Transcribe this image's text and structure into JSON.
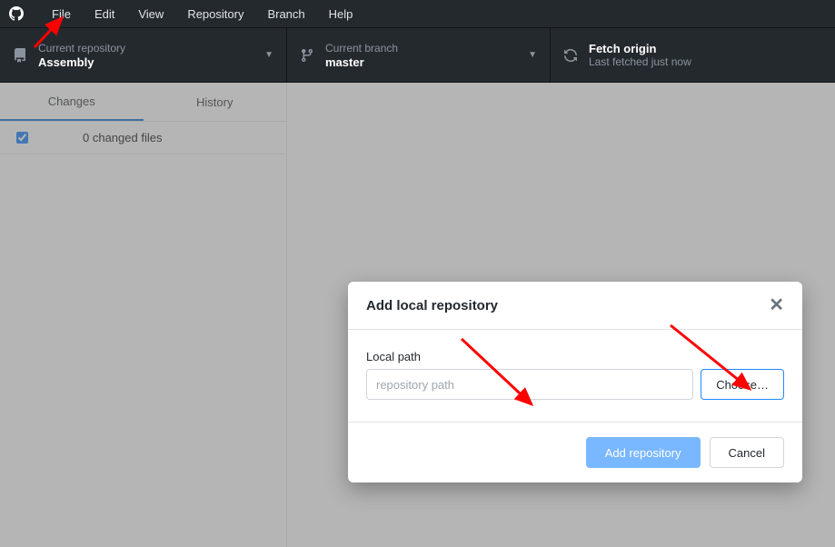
{
  "menubar": {
    "items": [
      "File",
      "Edit",
      "View",
      "Repository",
      "Branch",
      "Help"
    ]
  },
  "toolbar": {
    "repo": {
      "label": "Current repository",
      "value": "Assembly"
    },
    "branch": {
      "label": "Current branch",
      "value": "master"
    },
    "fetch": {
      "label": "Fetch origin",
      "sublabel": "Last fetched just now"
    }
  },
  "sidebar": {
    "tabs": {
      "changes": "Changes",
      "history": "History"
    },
    "changed_files": "0 changed files"
  },
  "modal": {
    "title": "Add local repository",
    "field_label": "Local path",
    "input_placeholder": "repository path",
    "choose": "Choose…",
    "primary": "Add repository",
    "secondary": "Cancel"
  },
  "colors": {
    "accent": "#0366d6",
    "menubar_bg": "#24292e"
  }
}
